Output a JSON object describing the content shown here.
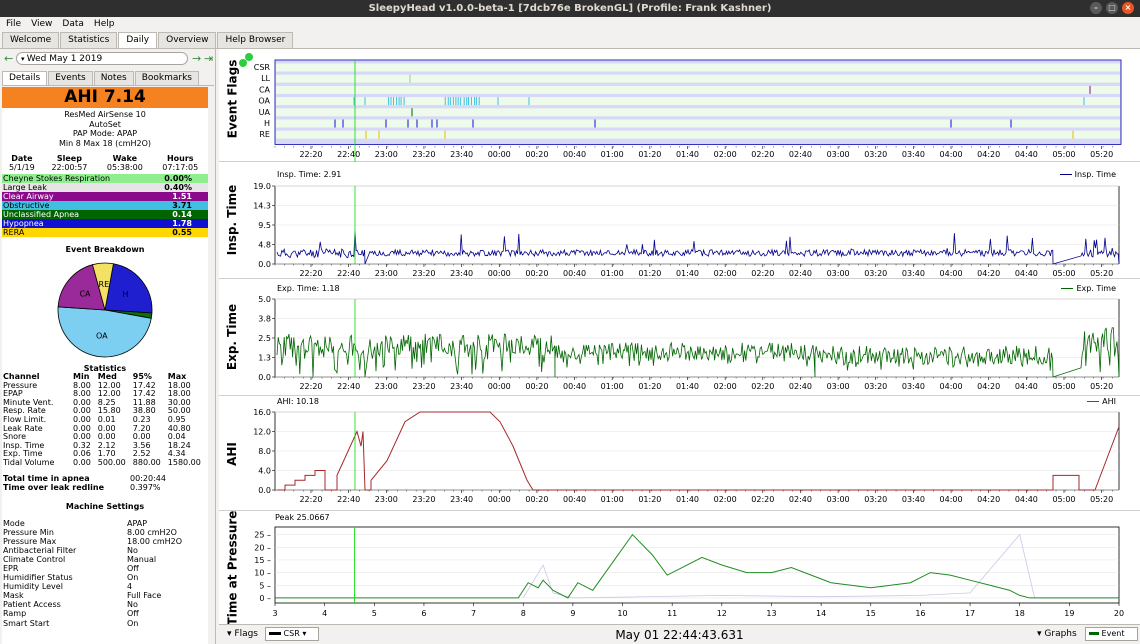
{
  "window": {
    "title": "SleepyHead v1.0.0-beta-1 [7dcb76e BrokenGL] (Profile: Frank Kashner)"
  },
  "menu": [
    "File",
    "View",
    "Data",
    "Help"
  ],
  "tabs": [
    {
      "label": "Welcome",
      "active": false
    },
    {
      "label": "Statistics",
      "active": false
    },
    {
      "label": "Daily",
      "active": true
    },
    {
      "label": "Overview",
      "active": false
    },
    {
      "label": "Help Browser",
      "active": false
    }
  ],
  "date_nav": {
    "date": "Wed May 1 2019"
  },
  "subtabs": [
    {
      "label": "Details",
      "active": true
    },
    {
      "label": "Events",
      "active": false
    },
    {
      "label": "Notes",
      "active": false
    },
    {
      "label": "Bookmarks",
      "active": false
    }
  ],
  "summary": {
    "ahi": "AHI 7.14",
    "machine": "ResMed AirSense 10",
    "mode_name": "AutoSet",
    "pap_mode": "PAP Mode: APAP",
    "pressure_range": "Min 8 Max 18 (cmH2O)"
  },
  "sleep_table": {
    "headers": [
      "Date",
      "Sleep",
      "Wake",
      "Hours"
    ],
    "values": [
      "5/1/19",
      "22:00:57",
      "05:38:00",
      "07:17:05"
    ]
  },
  "events": [
    {
      "label": "Cheyne Stokes Respiration",
      "value": "0.00%",
      "bg": "#90ee90",
      "fg": "#000000"
    },
    {
      "label": "Large Leak",
      "value": "0.40%",
      "bg": "#e7e3e7",
      "fg": "#000000"
    },
    {
      "label": "Clear Airway",
      "value": "1.51",
      "bg": "#8b0a8b",
      "fg": "#ffffff"
    },
    {
      "label": "Obstructive",
      "value": "3.71",
      "bg": "#40bfe0",
      "fg": "#000000"
    },
    {
      "label": "Unclassified Apnea",
      "value": "0.14",
      "bg": "#006400",
      "fg": "#ffffff"
    },
    {
      "label": "Hypopnea",
      "value": "1.78",
      "bg": "#1010d0",
      "fg": "#ffffff"
    },
    {
      "label": "RERA",
      "value": "0.55",
      "bg": "#ffd700",
      "fg": "#000000"
    }
  ],
  "pie": {
    "title": "Event Breakdown",
    "slices": [
      {
        "label": "H",
        "value": 1.78,
        "color": "#1f1fd0"
      },
      {
        "label": "UA",
        "value": 0.14,
        "color": "#0a6e0a"
      },
      {
        "label": "OA",
        "value": 3.71,
        "color": "#7ccff0"
      },
      {
        "label": "CA",
        "value": 1.51,
        "color": "#9a2a9a"
      },
      {
        "label": "RE",
        "value": 0.55,
        "color": "#f3e163"
      }
    ]
  },
  "statistics": {
    "title": "Statistics",
    "headers": [
      "Channel",
      "Min",
      "Med",
      "95%",
      "Max"
    ],
    "rows": [
      [
        "Pressure",
        "8.00",
        "12.00",
        "17.42",
        "18.00"
      ],
      [
        "EPAP",
        "8.00",
        "12.00",
        "17.42",
        "18.00"
      ],
      [
        "Minute Vent.",
        "0.00",
        "8.25",
        "11.88",
        "30.00"
      ],
      [
        "Resp. Rate",
        "0.00",
        "15.80",
        "38.80",
        "50.00"
      ],
      [
        "Flow Limit.",
        "0.00",
        "0.01",
        "0.23",
        "0.95"
      ],
      [
        "Leak Rate",
        "0.00",
        "0.00",
        "7.20",
        "40.80"
      ],
      [
        "Snore",
        "0.00",
        "0.00",
        "0.00",
        "0.04"
      ],
      [
        "Insp. Time",
        "0.32",
        "2.12",
        "3.56",
        "18.24"
      ],
      [
        "Exp. Time",
        "0.06",
        "1.70",
        "2.52",
        "4.34"
      ],
      [
        "Tidal Volume",
        "0.00",
        "500.00",
        "880.00",
        "1580.00"
      ]
    ],
    "total_apnea_label": "Total time in apnea",
    "total_apnea_value": "00:20:44",
    "leak_label": "Time over leak redline",
    "leak_value": "0.397%"
  },
  "machine_settings": {
    "title": "Machine Settings",
    "rows": [
      [
        "Mode",
        "APAP"
      ],
      [
        "Pressure Min",
        "8.00 cmH2O"
      ],
      [
        "Pressure Max",
        "18.00 cmH2O"
      ],
      [
        "Antibacterial Filter",
        "No"
      ],
      [
        "Climate Control",
        "Manual"
      ],
      [
        "EPR",
        "Off"
      ],
      [
        "Humidifier Status",
        "On"
      ],
      [
        "Humidity Level",
        "4"
      ],
      [
        "Mask",
        "Full Face"
      ],
      [
        "Patient Access",
        "No"
      ],
      [
        "Ramp",
        "Off"
      ],
      [
        "Smart Start",
        "On"
      ]
    ]
  },
  "time_axis": [
    "22:20",
    "22:40",
    "23:00",
    "23:20",
    "23:40",
    "00:00",
    "00:20",
    "00:40",
    "01:00",
    "01:20",
    "01:40",
    "02:00",
    "02:20",
    "02:40",
    "03:00",
    "03:20",
    "03:40",
    "04:00",
    "04:20",
    "04:40",
    "05:00",
    "05:20"
  ],
  "event_flags": {
    "ylabel": "Event Flags",
    "rows": [
      "CSR",
      "LL",
      "CA",
      "OA",
      "UA",
      "H",
      "RE"
    ]
  },
  "insp_time": {
    "ylabel": "Insp. Time",
    "title": "Insp. Time: 2.91",
    "legend": "Insp. Time",
    "yticks": [
      "19.0",
      "14.3",
      "9.5",
      "4.8",
      "0.0"
    ],
    "ymax": 19.0,
    "color": "#00008b"
  },
  "exp_time": {
    "ylabel": "Exp. Time",
    "title": "Exp. Time: 1.18",
    "legend": "Exp. Time",
    "yticks": [
      "5.0",
      "3.8",
      "2.5",
      "1.3",
      "0.0"
    ],
    "ymax": 5.0,
    "color": "#006400"
  },
  "ahi_chart": {
    "ylabel": "AHI",
    "title": "AHI: 10.18",
    "legend": "AHI",
    "yticks": [
      "16.0",
      "12.0",
      "8.0",
      "4.0",
      "0.0"
    ],
    "ymax": 16.0,
    "color": "#a52a2a"
  },
  "pressure_chart": {
    "ylabel": "Time at Pressure",
    "title": "Peak 25.0667",
    "yticks": [
      "25",
      "20",
      "15",
      "10",
      "5",
      "0"
    ],
    "ytick_vals": [
      25,
      20,
      15,
      10,
      5,
      0
    ],
    "xticks": [
      "3",
      "4",
      "5",
      "6",
      "7",
      "8",
      "9",
      "10",
      "11",
      "12",
      "13",
      "14",
      "15",
      "16",
      "17",
      "18",
      "19",
      "20"
    ],
    "xmin": 3,
    "xmax": 20,
    "ymin": -2,
    "ymax": 28
  },
  "bottom_bar": {
    "flags_label": "Flags",
    "flags_combo": "CSR",
    "timestamp": "May 01 22:44:43.631",
    "graphs_label": "Graphs",
    "events_combo": "Event"
  }
}
